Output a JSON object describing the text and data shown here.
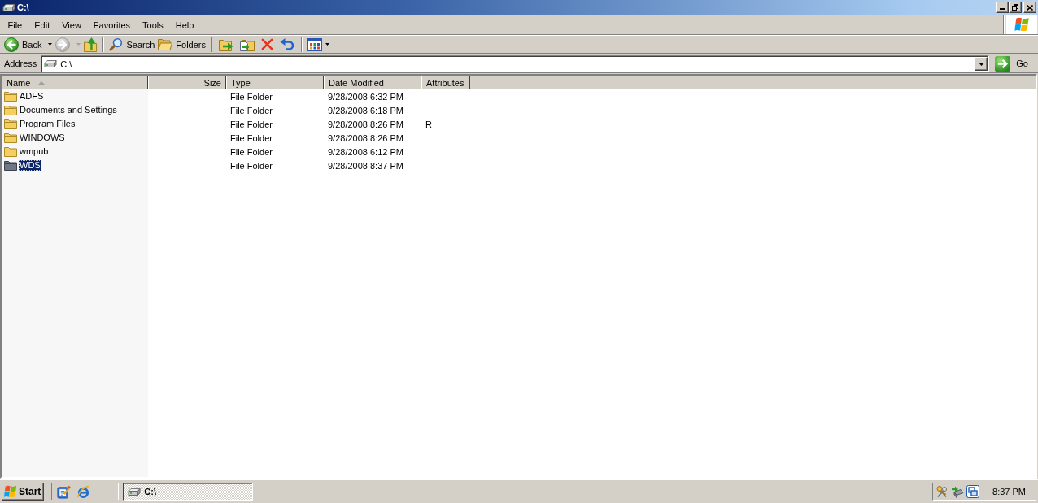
{
  "window": {
    "title": "C:\\"
  },
  "menu_bar": [
    "File",
    "Edit",
    "View",
    "Favorites",
    "Tools",
    "Help"
  ],
  "toolbar": {
    "back": {
      "label": "Back",
      "disabled": false
    },
    "forward": {
      "disabled": true
    },
    "search": {
      "label": "Search"
    },
    "folders": {
      "label": "Folders"
    }
  },
  "address_bar": {
    "label": "Address",
    "value": "C:\\",
    "go_label": "Go"
  },
  "table": {
    "columns": [
      {
        "label": "Name",
        "sorted": true
      },
      {
        "label": "Size",
        "sorted": false
      },
      {
        "label": "Type",
        "sorted": false
      },
      {
        "label": "Date Modified",
        "sorted": false
      },
      {
        "label": "Attributes",
        "sorted": false
      }
    ],
    "rows": [
      {
        "name": "ADFS",
        "type": "File Folder",
        "date_modified": "9/28/2008 6:32 PM",
        "selected": false
      },
      {
        "name": "Documents and Settings",
        "type": "File Folder",
        "date_modified": "9/28/2008 6:18 PM",
        "selected": false
      },
      {
        "name": "Program Files",
        "type": "File Folder",
        "date_modified": "9/28/2008 8:26 PM",
        "attributes": "R",
        "selected": false
      },
      {
        "name": "WINDOWS",
        "type": "File Folder",
        "date_modified": "9/28/2008 8:26 PM",
        "selected": false
      },
      {
        "name": "wmpub",
        "type": "File Folder",
        "date_modified": "9/28/2008 6:12 PM",
        "selected": false
      },
      {
        "name": "WDS",
        "type": "File Folder",
        "date_modified": "9/28/2008 8:37 PM",
        "selected": true
      }
    ]
  },
  "taskbar": {
    "start_label": "Start",
    "tasks": [
      {
        "label": "C:\\",
        "selected": true
      }
    ],
    "clock": "8:37 PM"
  }
}
